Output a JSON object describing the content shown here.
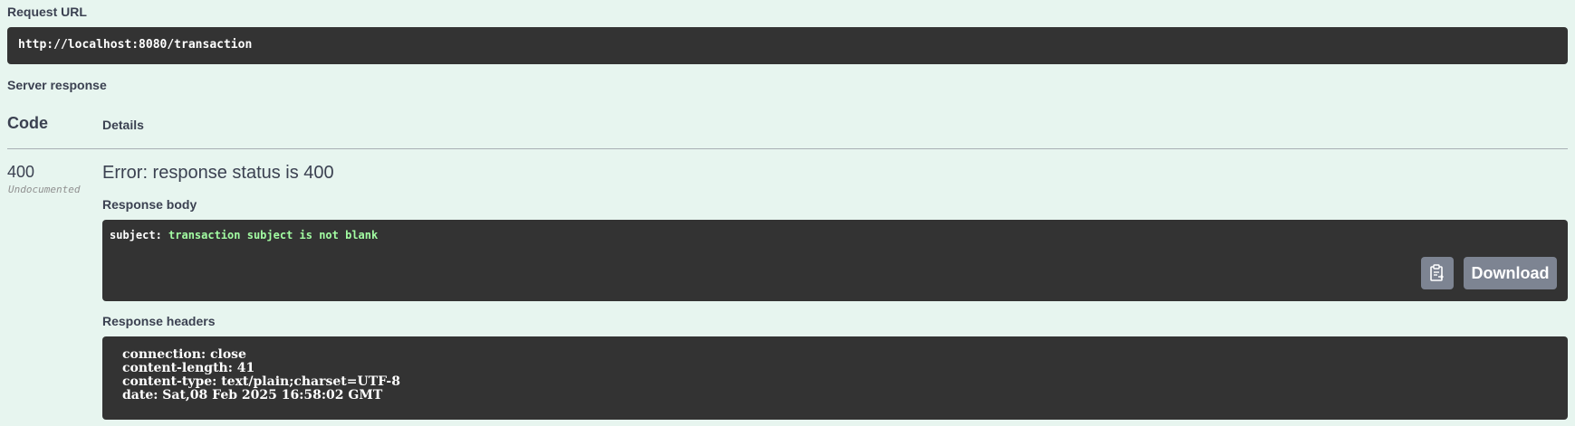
{
  "request_url": {
    "label": "Request URL",
    "value": "http://localhost:8080/transaction"
  },
  "server_response": {
    "label": "Server response",
    "columns": {
      "code": "Code",
      "details": "Details"
    },
    "row": {
      "code": "400",
      "code_note": "Undocumented",
      "error_title": "Error: response status is 400",
      "response_body_label": "Response body",
      "response_body": {
        "key": "subject:",
        "value": "transaction subject is not blank"
      },
      "copy_icon": "clipboard-icon",
      "download_label": "Download",
      "response_headers_label": "Response headers",
      "response_headers": [
        "connection: close",
        "content-length: 41",
        "content-type: text/plain;charset=UTF-8",
        "date: Sat,08 Feb 2025 16:58:02 GMT"
      ]
    }
  }
}
